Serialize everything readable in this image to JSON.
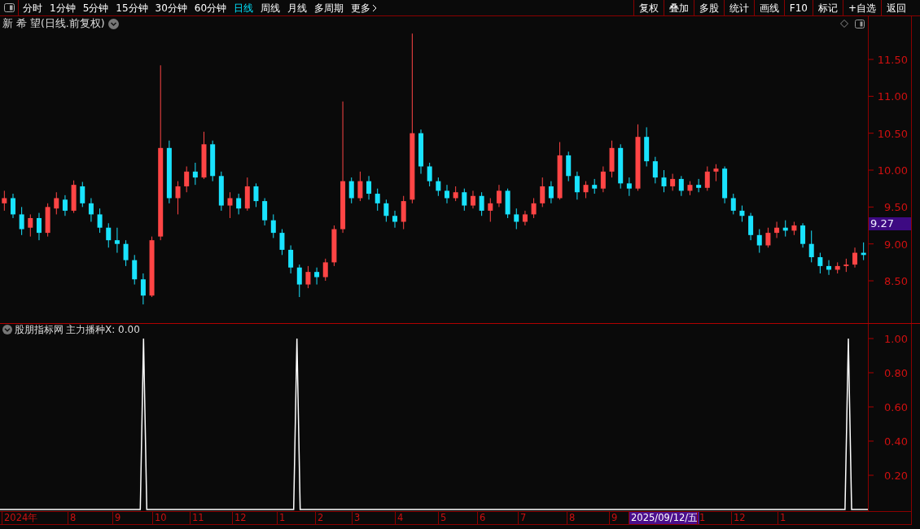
{
  "toolbar": {
    "periods": [
      {
        "label": "分时",
        "selected": false
      },
      {
        "label": "1分钟",
        "selected": false
      },
      {
        "label": "5分钟",
        "selected": false
      },
      {
        "label": "15分钟",
        "selected": false
      },
      {
        "label": "30分钟",
        "selected": false
      },
      {
        "label": "60分钟",
        "selected": false
      },
      {
        "label": "日线",
        "selected": true
      },
      {
        "label": "周线",
        "selected": false
      },
      {
        "label": "月线",
        "selected": false
      },
      {
        "label": "多周期",
        "selected": false
      }
    ],
    "more": "更多",
    "actions": [
      "复权",
      "叠加",
      "多股",
      "统计",
      "画线",
      "F10",
      "标记",
      "+自选",
      "返回"
    ]
  },
  "price_chart": {
    "title": "新 希 望(日线.前复权)",
    "current_price": "9.27",
    "chart_data": {
      "type": "candlestick",
      "ylim": [
        7.927,
        11.886
      ],
      "yticks": [
        {
          "value": 11.5,
          "label": "11.50"
        },
        {
          "value": 11,
          "label": "11.00"
        },
        {
          "value": 10.5,
          "label": "10.50"
        },
        {
          "value": 10,
          "label": "10.00"
        },
        {
          "value": 9.5,
          "label": "9.50"
        },
        {
          "value": 9,
          "label": "9.00"
        },
        {
          "value": 8.5,
          "label": "8.50"
        }
      ],
      "categories": [
        null,
        null,
        null,
        null,
        null,
        null,
        null,
        null,
        null,
        null,
        null,
        null,
        null,
        null,
        null,
        null,
        null,
        null,
        null,
        null,
        null,
        null,
        null,
        null,
        null,
        null,
        null,
        null,
        null,
        null,
        null,
        null,
        null,
        null,
        null,
        null,
        null,
        null,
        null,
        null,
        null,
        null,
        null,
        null,
        null,
        null,
        null,
        null,
        null,
        null,
        null,
        null,
        null,
        null,
        null,
        null,
        null,
        null,
        null,
        null,
        null,
        null,
        null,
        null,
        null,
        null,
        null,
        null,
        null,
        null,
        null,
        null,
        null,
        null,
        null,
        null,
        null,
        null,
        null,
        null,
        null,
        null,
        null,
        null,
        null,
        null,
        null,
        null,
        null,
        null,
        null,
        null,
        null,
        null,
        null,
        null,
        null,
        null,
        null,
        null
      ],
      "ohlc": [
        [
          9.55,
          9.72,
          9.45,
          9.62
        ],
        [
          9.62,
          9.68,
          9.35,
          9.4
        ],
        [
          9.4,
          9.5,
          9.12,
          9.2
        ],
        [
          9.22,
          9.4,
          9.1,
          9.35
        ],
        [
          9.35,
          9.42,
          9.05,
          9.15
        ],
        [
          9.15,
          9.55,
          9.1,
          9.5
        ],
        [
          9.48,
          9.7,
          9.4,
          9.62
        ],
        [
          9.6,
          9.66,
          9.38,
          9.45
        ],
        [
          9.45,
          9.86,
          9.42,
          9.8
        ],
        [
          9.78,
          9.84,
          9.5,
          9.55
        ],
        [
          9.55,
          9.62,
          9.3,
          9.4
        ],
        [
          9.4,
          9.48,
          9.15,
          9.22
        ],
        [
          9.22,
          9.28,
          8.95,
          9.05
        ],
        [
          9.05,
          9.22,
          8.88,
          9.0
        ],
        [
          9.0,
          9.05,
          8.7,
          8.78
        ],
        [
          8.78,
          8.85,
          8.45,
          8.52
        ],
        [
          8.52,
          8.6,
          8.18,
          8.3
        ],
        [
          8.3,
          9.1,
          8.28,
          9.05
        ],
        [
          9.1,
          11.42,
          9.05,
          10.3
        ],
        [
          10.3,
          10.4,
          9.55,
          9.62
        ],
        [
          9.62,
          9.85,
          9.4,
          9.78
        ],
        [
          9.78,
          10.05,
          9.7,
          9.98
        ],
        [
          9.98,
          10.1,
          9.8,
          9.9
        ],
        [
          9.9,
          10.52,
          9.88,
          10.35
        ],
        [
          10.35,
          10.4,
          9.85,
          9.92
        ],
        [
          9.92,
          9.98,
          9.45,
          9.52
        ],
        [
          9.52,
          9.7,
          9.35,
          9.62
        ],
        [
          9.62,
          9.68,
          9.4,
          9.48
        ],
        [
          9.48,
          9.9,
          9.45,
          9.78
        ],
        [
          9.78,
          9.82,
          9.5,
          9.58
        ],
        [
          9.58,
          9.62,
          9.25,
          9.32
        ],
        [
          9.32,
          9.4,
          9.08,
          9.15
        ],
        [
          9.15,
          9.2,
          8.85,
          8.92
        ],
        [
          8.92,
          8.98,
          8.6,
          8.68
        ],
        [
          8.68,
          8.72,
          8.28,
          8.45
        ],
        [
          8.45,
          8.7,
          8.4,
          8.62
        ],
        [
          8.62,
          8.68,
          8.45,
          8.55
        ],
        [
          8.55,
          8.8,
          8.5,
          8.75
        ],
        [
          8.75,
          9.25,
          8.7,
          9.2
        ],
        [
          9.2,
          10.93,
          9.15,
          9.85
        ],
        [
          9.85,
          9.9,
          9.55,
          9.62
        ],
        [
          9.62,
          9.98,
          9.58,
          9.85
        ],
        [
          9.85,
          9.92,
          9.6,
          9.68
        ],
        [
          9.68,
          9.75,
          9.45,
          9.55
        ],
        [
          9.55,
          9.6,
          9.3,
          9.38
        ],
        [
          9.38,
          9.45,
          9.22,
          9.3
        ],
        [
          9.3,
          9.65,
          9.2,
          9.58
        ],
        [
          9.6,
          11.85,
          9.55,
          10.5
        ],
        [
          10.5,
          10.55,
          9.95,
          10.05
        ],
        [
          10.05,
          10.1,
          9.78,
          9.85
        ],
        [
          9.85,
          9.9,
          9.65,
          9.72
        ],
        [
          9.72,
          9.8,
          9.55,
          9.62
        ],
        [
          9.62,
          9.78,
          9.58,
          9.7
        ],
        [
          9.7,
          9.75,
          9.45,
          9.52
        ],
        [
          9.52,
          9.72,
          9.48,
          9.65
        ],
        [
          9.65,
          9.7,
          9.38,
          9.45
        ],
        [
          9.45,
          9.62,
          9.3,
          9.55
        ],
        [
          9.55,
          9.8,
          9.5,
          9.72
        ],
        [
          9.72,
          9.75,
          9.35,
          9.4
        ],
        [
          9.4,
          9.48,
          9.2,
          9.3
        ],
        [
          9.3,
          9.45,
          9.25,
          9.4
        ],
        [
          9.4,
          9.62,
          9.35,
          9.55
        ],
        [
          9.55,
          9.9,
          9.5,
          9.78
        ],
        [
          9.78,
          9.85,
          9.55,
          9.62
        ],
        [
          9.62,
          10.38,
          9.6,
          10.2
        ],
        [
          10.2,
          10.25,
          9.85,
          9.92
        ],
        [
          9.92,
          9.98,
          9.6,
          9.7
        ],
        [
          9.7,
          9.85,
          9.62,
          9.8
        ],
        [
          9.8,
          9.88,
          9.68,
          9.75
        ],
        [
          9.75,
          10.05,
          9.7,
          9.98
        ],
        [
          9.98,
          10.4,
          9.9,
          10.3
        ],
        [
          10.3,
          10.35,
          9.75,
          9.82
        ],
        [
          9.82,
          9.9,
          9.65,
          9.75
        ],
        [
          9.75,
          10.62,
          9.72,
          10.45
        ],
        [
          10.45,
          10.58,
          10.05,
          10.12
        ],
        [
          10.12,
          10.18,
          9.82,
          9.9
        ],
        [
          9.9,
          10.0,
          9.7,
          9.78
        ],
        [
          9.78,
          9.95,
          9.72,
          9.88
        ],
        [
          9.88,
          9.92,
          9.65,
          9.72
        ],
        [
          9.72,
          9.85,
          9.66,
          9.8
        ],
        [
          9.8,
          9.88,
          9.7,
          9.76
        ],
        [
          9.76,
          10.05,
          9.72,
          9.98
        ],
        [
          9.98,
          10.08,
          9.85,
          10.02
        ],
        [
          10.02,
          10.05,
          9.55,
          9.62
        ],
        [
          9.62,
          9.68,
          9.4,
          9.45
        ],
        [
          9.45,
          9.52,
          9.3,
          9.38
        ],
        [
          9.38,
          9.42,
          9.05,
          9.12
        ],
        [
          9.12,
          9.2,
          8.88,
          8.98
        ],
        [
          8.98,
          9.22,
          8.95,
          9.15
        ],
        [
          9.15,
          9.3,
          9.08,
          9.22
        ],
        [
          9.22,
          9.32,
          9.1,
          9.18
        ],
        [
          9.18,
          9.3,
          9.12,
          9.25
        ],
        [
          9.25,
          9.28,
          8.95,
          9.0
        ],
        [
          9.0,
          9.18,
          8.75,
          8.82
        ],
        [
          8.82,
          8.88,
          8.6,
          8.7
        ],
        [
          8.7,
          8.78,
          8.58,
          8.65
        ],
        [
          8.65,
          8.75,
          8.6,
          8.7
        ],
        [
          8.7,
          8.8,
          8.62,
          8.72
        ],
        [
          8.72,
          8.95,
          8.68,
          8.88
        ],
        [
          8.88,
          9.02,
          8.78,
          8.85
        ]
      ]
    }
  },
  "indicator": {
    "title": "股朋指标网",
    "reading": ": 0.00",
    "chart_data": {
      "type": "line",
      "ylim": [
        0,
        1.019
      ],
      "yticks": [
        {
          "value": 1,
          "label": "1.00"
        },
        {
          "value": 0.8,
          "label": "0.80"
        },
        {
          "value": 0.6,
          "label": "0.60"
        },
        {
          "value": 0.4,
          "label": "0.40"
        },
        {
          "value": 0.2,
          "label": "0.20"
        }
      ],
      "categories": [
        null,
        null,
        null,
        null,
        null,
        null,
        null,
        null,
        null,
        null,
        null,
        null,
        null,
        null,
        null,
        null,
        null,
        null,
        null,
        null,
        null,
        null,
        null,
        null,
        null,
        null,
        null,
        null,
        null,
        null,
        null,
        null,
        null,
        null,
        null,
        null,
        null,
        null,
        null,
        null,
        null,
        null,
        null,
        null,
        null,
        null,
        null,
        null,
        null,
        null,
        null,
        null,
        null,
        null,
        null,
        null,
        null,
        null,
        null,
        null,
        null,
        null,
        null,
        null,
        null,
        null,
        null,
        null,
        null,
        null,
        null,
        null,
        null,
        null,
        null,
        null,
        null,
        null,
        null,
        null,
        null,
        null,
        null,
        null,
        null,
        null,
        null,
        null,
        null,
        null,
        null,
        null,
        null,
        null,
        null,
        null,
        null,
        null,
        null,
        null,
        null,
        null,
        null,
        null,
        null,
        null,
        null,
        null,
        null,
        null,
        null,
        null,
        null,
        null,
        null,
        null,
        null,
        null,
        null,
        null,
        null,
        null,
        null,
        null,
        null,
        null,
        null,
        null,
        null,
        null,
        null,
        null,
        null,
        null,
        null,
        null,
        null,
        null,
        null,
        null,
        null,
        null,
        null,
        null,
        null,
        null,
        null,
        null,
        null,
        null,
        null,
        null,
        null,
        null,
        null,
        null,
        null,
        null,
        null,
        null,
        null,
        null,
        null,
        null,
        null,
        null,
        null,
        null,
        null,
        null,
        null,
        null,
        null,
        null,
        null,
        null,
        null,
        null,
        null,
        null,
        null,
        null,
        null,
        null,
        null,
        null,
        null,
        null,
        null,
        null,
        null,
        null,
        null,
        null,
        null,
        null,
        null,
        null,
        null,
        null,
        null,
        null,
        null,
        null,
        null,
        null,
        null,
        null,
        null,
        null,
        null,
        null,
        null,
        null,
        null,
        null,
        null,
        null,
        null,
        null,
        null,
        null,
        null,
        null,
        null,
        null,
        null,
        null,
        null,
        null,
        null,
        null,
        null,
        null,
        null,
        null,
        null,
        null,
        null,
        null,
        null,
        null,
        null,
        null,
        null,
        null,
        null,
        null,
        null,
        null,
        null,
        null,
        null,
        null,
        null,
        null,
        null,
        null,
        null,
        null,
        null,
        null,
        null,
        null,
        null,
        null,
        null
      ],
      "series": [
        {
          "name": "主力播种X",
          "color": "#ffffff",
          "values": [
            0,
            0,
            0,
            0,
            0,
            0,
            0,
            0,
            0,
            0,
            0,
            0,
            0,
            0,
            0,
            0,
            0,
            0,
            0,
            0,
            0,
            0,
            0,
            0,
            0,
            0,
            0,
            0,
            0,
            0,
            0,
            0,
            0,
            0,
            0,
            0,
            0,
            0,
            0,
            0,
            0,
            0,
            0,
            0,
            1,
            0,
            0,
            0,
            0,
            0,
            0,
            0,
            0,
            0,
            0,
            0,
            0,
            0,
            0,
            0,
            0,
            0,
            0,
            0,
            0,
            0,
            0,
            0,
            0,
            0,
            0,
            0,
            0,
            0,
            0,
            0,
            0,
            0,
            0,
            0,
            0,
            0,
            0,
            0,
            0,
            0,
            0,
            0,
            0,
            0,
            0,
            1,
            0,
            0,
            0,
            0,
            0,
            0,
            0,
            0,
            0,
            0,
            0,
            0,
            0,
            0,
            0,
            0,
            0,
            0,
            0,
            0,
            0,
            0,
            0,
            0,
            0,
            0,
            0,
            0,
            0,
            0,
            0,
            0,
            0,
            0,
            0,
            0,
            0,
            0,
            0,
            0,
            0,
            0,
            0,
            0,
            0,
            0,
            0,
            0,
            0,
            0,
            0,
            0,
            0,
            0,
            0,
            0,
            0,
            0,
            0,
            0,
            0,
            0,
            0,
            0,
            0,
            0,
            0,
            0,
            0,
            0,
            0,
            0,
            0,
            0,
            0,
            0,
            0,
            0,
            0,
            0,
            0,
            0,
            0,
            0,
            0,
            0,
            0,
            0,
            0,
            0,
            0,
            0,
            0,
            0,
            0,
            0,
            0,
            0,
            0,
            0,
            0,
            0,
            0,
            0,
            0,
            0,
            0,
            0,
            0,
            0,
            0,
            0,
            0,
            0,
            0,
            0,
            0,
            0,
            0,
            0,
            0,
            0,
            0,
            0,
            0,
            0,
            0,
            0,
            0,
            0,
            0,
            0,
            0,
            0,
            0,
            0,
            0,
            0,
            0,
            0,
            0,
            0,
            0,
            0,
            0,
            0,
            0,
            0,
            0,
            0,
            0,
            0,
            0,
            0,
            0,
            0,
            0,
            0,
            0,
            0,
            0,
            0,
            0,
            0,
            0,
            0,
            0,
            0,
            1,
            0,
            0,
            0,
            0,
            0,
            0
          ]
        }
      ]
    }
  },
  "date_axis": [
    {
      "label": "2024年",
      "selected": false
    },
    {
      "label": "8",
      "selected": false
    },
    {
      "label": "9",
      "selected": false
    },
    {
      "label": "10",
      "selected": false
    },
    {
      "label": "11",
      "selected": false
    },
    {
      "label": "12",
      "selected": false
    },
    {
      "label": "1",
      "selected": false
    },
    {
      "label": "2",
      "selected": false
    },
    {
      "label": "3",
      "selected": false
    },
    {
      "label": "4",
      "selected": false
    },
    {
      "label": "5",
      "selected": false
    },
    {
      "label": "6",
      "selected": false
    },
    {
      "label": "7",
      "selected": false
    },
    {
      "label": "8",
      "selected": false
    },
    {
      "label": "9",
      "selected": false
    },
    {
      "label": "2025/09/12/五",
      "selected": true
    },
    {
      "label": "1",
      "selected": false
    },
    {
      "label": "12",
      "selected": false
    },
    {
      "label": "1",
      "selected": false
    }
  ]
}
